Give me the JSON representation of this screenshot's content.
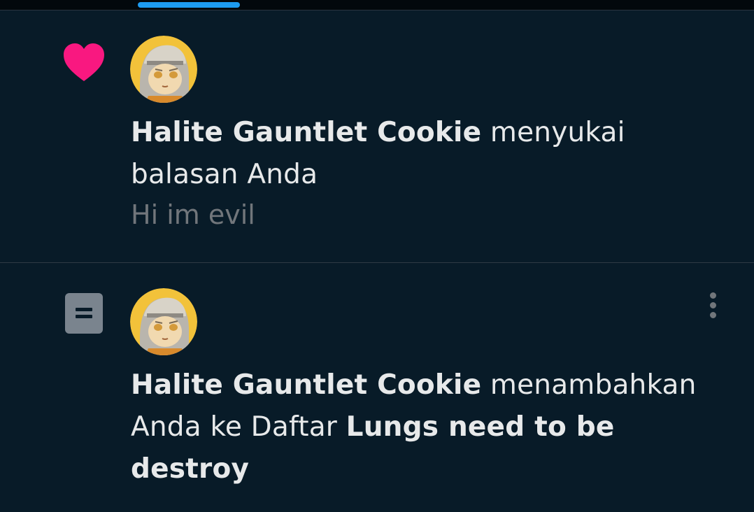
{
  "notifications": [
    {
      "type_icon": "heart-icon",
      "actor": "Halite Gauntlet Cookie",
      "action": "menyukai balasan Anda",
      "snippet": "Hi im evil"
    },
    {
      "type_icon": "list-icon",
      "actor": "Halite Gauntlet Cookie",
      "action": "menambahkan Anda ke Daftar",
      "list_name": "Lungs need to be destroy",
      "menu_icon": "more-vertical-icon"
    }
  ],
  "colors": {
    "background": "#081b28",
    "accent": "#1d9bf0",
    "like": "#f91880",
    "text": "#e7e9ea",
    "muted": "#71767b"
  }
}
